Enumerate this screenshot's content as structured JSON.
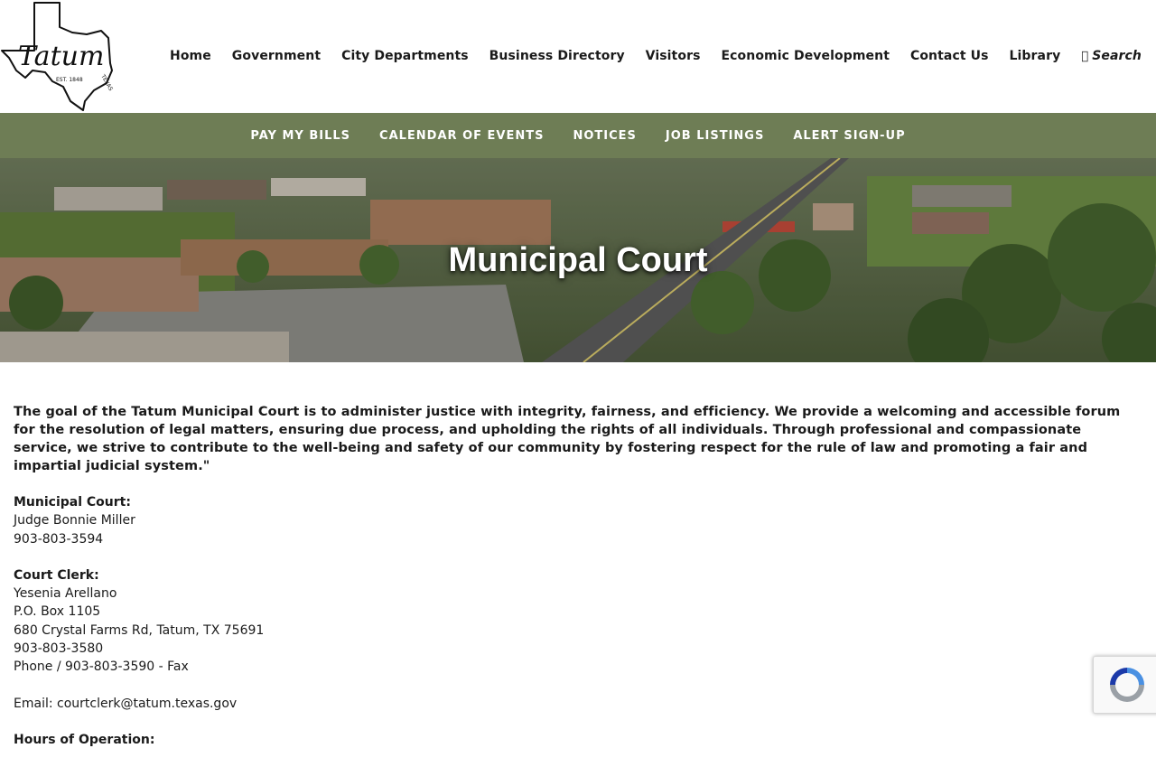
{
  "header": {
    "logo": {
      "name": "Tatum",
      "est": "EST. 1848",
      "state": "TEXAS"
    },
    "nav": [
      {
        "label": "Home"
      },
      {
        "label": "Government"
      },
      {
        "label": "City Departments"
      },
      {
        "label": "Business Directory"
      },
      {
        "label": "Visitors"
      },
      {
        "label": "Economic Development"
      },
      {
        "label": "Contact Us"
      },
      {
        "label": "Library"
      }
    ],
    "search": {
      "glyph": "",
      "label": "Search",
      "icon": "search-icon"
    }
  },
  "subnav": [
    {
      "label": "PAY MY BILLS"
    },
    {
      "label": "CALENDAR OF EVENTS"
    },
    {
      "label": "NOTICES"
    },
    {
      "label": "JOB LISTINGS"
    },
    {
      "label": "ALERT SIGN-UP"
    }
  ],
  "colors": {
    "subnav_bg": "#6e7d55"
  },
  "hero": {
    "title": "Municipal Court"
  },
  "content": {
    "mission": "The goal of the Tatum Municipal Court is to administer justice with integrity, fairness, and efficiency. We provide a welcoming and accessible forum for the resolution of legal matters, ensuring due process, and upholding the rights of all individuals. Through professional and compassionate service, we strive to contribute to the well-being and safety of our community by fostering respect for the rule of law and promoting a fair and impartial judicial system.\"",
    "court": {
      "label": "Municipal Court:",
      "judge": "Judge Bonnie Miller",
      "phone": "903-803-3594"
    },
    "clerk": {
      "label": "Court Clerk:",
      "name": "Yesenia Arellano",
      "po_box": "P.O. Box 1105",
      "address": "680 Crystal Farms Rd, Tatum, TX 75691",
      "phone": "903-803-3580",
      "phone_fax": "Phone / 903-803-3590 - Fax"
    },
    "email": "Email: courtclerk@tatum.texas.gov",
    "hours_label": "Hours of Operation:"
  }
}
